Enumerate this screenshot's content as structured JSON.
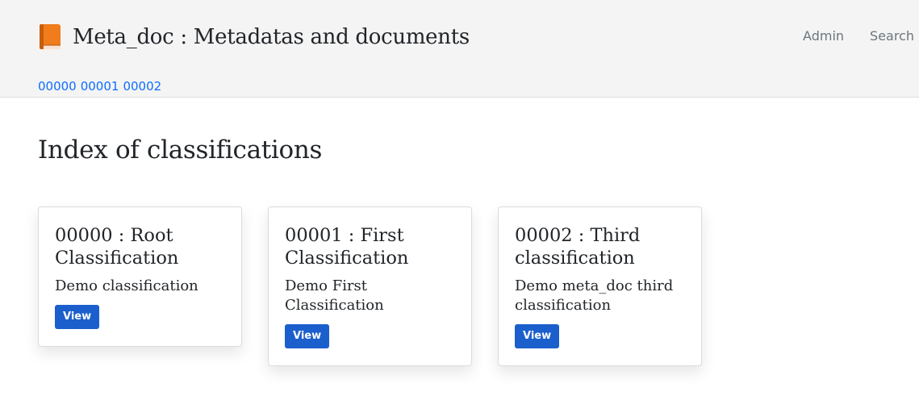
{
  "header": {
    "brand_icon": "orange-book-icon",
    "title": "Meta_doc : Metadatas and documents",
    "nav": [
      {
        "label": "Admin"
      },
      {
        "label": "Search"
      }
    ],
    "crumbs": [
      "00000",
      "00001",
      "00002"
    ]
  },
  "main": {
    "title": "Index of classifications",
    "cards": [
      {
        "title": "00000 : Root Classification",
        "text": "Demo classification",
        "button": "View"
      },
      {
        "title": "00001 : First Classification",
        "text": "Demo First Classification",
        "button": "View"
      },
      {
        "title": "00002 : Third classification",
        "text": "Demo meta_doc third classification",
        "button": "View"
      }
    ]
  },
  "colors": {
    "header_bg": "#f4f4f4",
    "link": "#0d6efd",
    "button": "#1b5fcd",
    "icon_orange": "#f07c1b"
  }
}
